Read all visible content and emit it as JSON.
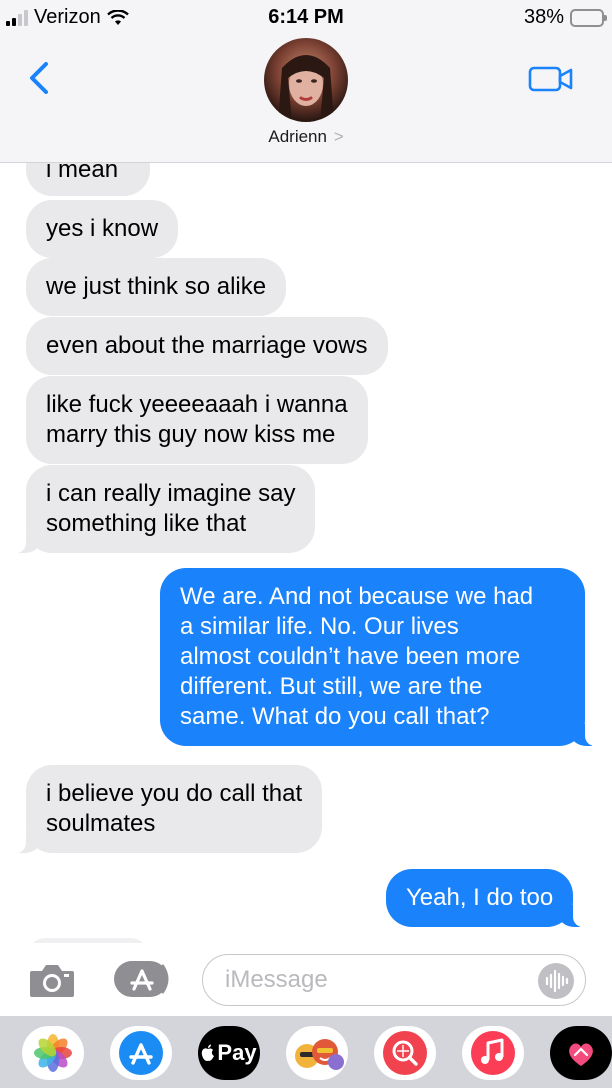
{
  "status_bar": {
    "carrier": "Verizon",
    "time": "6:14 PM",
    "battery": "38%",
    "battery_level": 0.38
  },
  "header": {
    "contact_name": "Adrienn",
    "chevron": ">"
  },
  "messages": [
    {
      "direction": "incoming",
      "text": "i mean"
    },
    {
      "direction": "incoming",
      "text": "yes i know"
    },
    {
      "direction": "incoming",
      "text": "we just think so alike"
    },
    {
      "direction": "incoming",
      "text": "even about the marriage vows"
    },
    {
      "direction": "incoming",
      "line1": "like fuck yeeeeaaah i wanna",
      "line2": "marry this guy now kiss me"
    },
    {
      "direction": "incoming",
      "line1": "i can really imagine say",
      "line2": "something like that"
    },
    {
      "direction": "outgoing",
      "lines": [
        "We are. And not because we had",
        "a similar life. No. Our lives",
        "almost couldn’t have been more",
        "different. But still, we are the",
        "same. What do you call that?"
      ]
    },
    {
      "direction": "incoming",
      "line1": "i believe you do call that",
      "line2": "soulmates"
    },
    {
      "direction": "outgoing",
      "text": "Yeah, I do too"
    }
  ],
  "input": {
    "placeholder": "iMessage"
  },
  "app_drawer": {
    "apple_pay_label": "Pay"
  },
  "colors": {
    "accent": "#1a82fb",
    "incoming_bubble": "#e9e9eb",
    "battery": "#ffd60a"
  }
}
